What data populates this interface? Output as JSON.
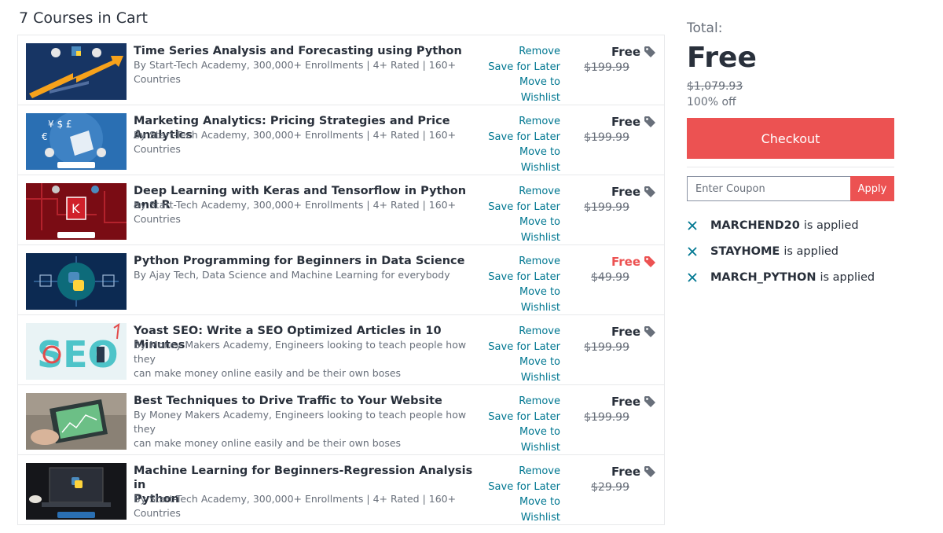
{
  "cart": {
    "heading": "7 Courses in Cart",
    "actions": {
      "remove": "Remove",
      "save_later": "Save for Later",
      "wishlist": "Move to Wishlist"
    },
    "courses": [
      {
        "title": "Time Series Analysis and Forecasting using Python",
        "title2": "",
        "subtitle": "By Start-Tech Academy, 300,000+ Enrollments | 4+ Rated | 160+ Countries",
        "subtitle2": "",
        "price": "Free",
        "old_price": "$199.99",
        "thumb": "time-series-thumbnail"
      },
      {
        "title": "Marketing Analytics: Pricing Strategies and Price Analytics",
        "title2": "",
        "subtitle": "By Start-Tech Academy, 300,000+ Enrollments | 4+ Rated | 160+ Countries",
        "subtitle2": "",
        "price": "Free",
        "old_price": "$199.99",
        "thumb": "marketing-analytics-thumbnail"
      },
      {
        "title": "Deep Learning with Keras and Tensorflow in Python and R",
        "title2": "",
        "subtitle": "By Start-Tech Academy, 300,000+ Enrollments | 4+ Rated | 160+ Countries",
        "subtitle2": "",
        "price": "Free",
        "old_price": "$199.99",
        "thumb": "deep-learning-thumbnail"
      },
      {
        "title": "Python Programming for Beginners in Data Science",
        "title2": "",
        "subtitle": "By Ajay Tech, Data Science and Machine Learning for everybody",
        "subtitle2": "",
        "price": "Free",
        "old_price": "$49.99",
        "thumb": "python-programming-thumbnail"
      },
      {
        "title": "Yoast SEO: Write a SEO Optimized Articles in 10 Minutes",
        "title2": "",
        "subtitle": "By Money Makers Academy, Engineers looking to teach people how they",
        "subtitle2": "can make money online easily and be their own boses",
        "price": "Free",
        "old_price": "$199.99",
        "thumb": "seo-thumbnail"
      },
      {
        "title": "Best Techniques to Drive Traffic to Your Website",
        "title2": "",
        "subtitle": "By Money Makers Academy, Engineers looking to teach people how they",
        "subtitle2": "can make money online easily and be their own boses",
        "price": "Free",
        "old_price": "$199.99",
        "thumb": "traffic-thumbnail"
      },
      {
        "title": "Machine Learning for Beginners-Regression Analysis in",
        "title2": "Python",
        "subtitle": "By Start-Tech Academy, 300,000+ Enrollments | 4+ Rated | 160+ Countries",
        "subtitle2": "",
        "price": "Free",
        "old_price": "$29.99",
        "thumb": "machine-learning-thumbnail"
      }
    ]
  },
  "summary": {
    "total_label": "Total:",
    "total_price": "Free",
    "original_total": "$1,079.93",
    "discount": "100% off",
    "checkout_label": "Checkout",
    "coupon_placeholder": "Enter Coupon",
    "apply_label": "Apply",
    "applied_suffix": "is applied",
    "coupons": [
      "MARCHEND20",
      "STAYHOME",
      "MARCH_PYTHON"
    ]
  },
  "colors": {
    "accent_red": "#ec5252",
    "link_teal": "#007791",
    "text_dark": "#29303b",
    "text_muted": "#686f7a",
    "tag_gray": "#686f7a"
  },
  "icons": {
    "price_tag": "tag-icon",
    "remove_coupon": "close-icon"
  }
}
